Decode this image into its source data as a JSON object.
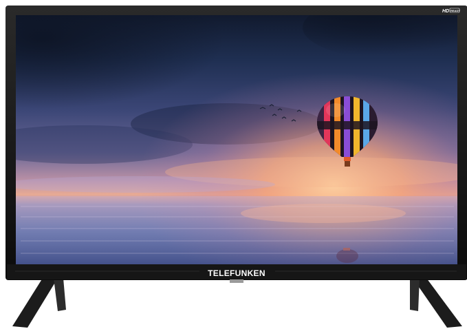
{
  "product": {
    "brand_label": "TELEFUNKEN",
    "hd_badge_label": "HD",
    "hd_badge_sub": "READY"
  },
  "scene": {
    "subject": "hot-air-balloon",
    "colors": {
      "sky_top": "#1b2740",
      "sky_mid": "#4d4f86",
      "horizon_glow": "#f4a27a",
      "sea": "#6f7fb4",
      "bezel": "#111111",
      "brand_text": "#ffffff"
    }
  }
}
